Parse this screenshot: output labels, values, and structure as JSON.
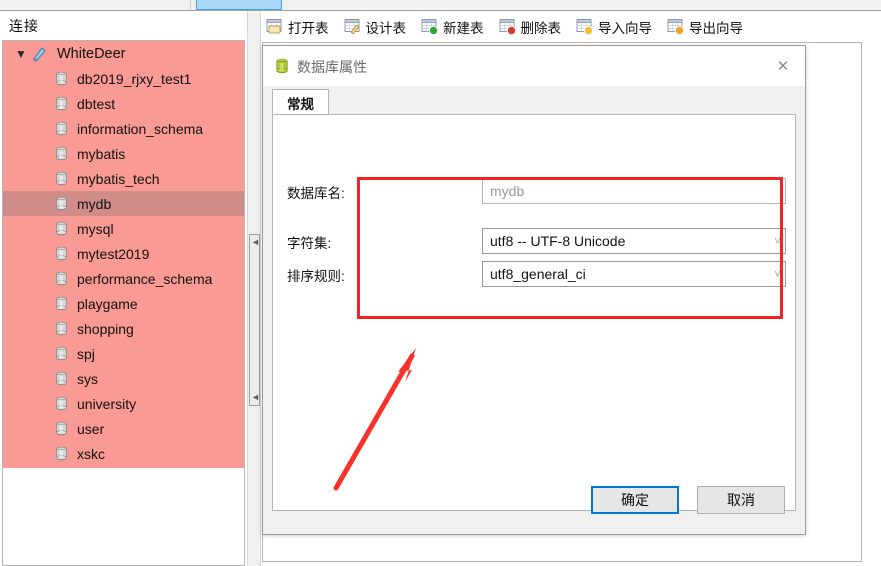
{
  "window": {
    "top_strip_note": "partially visible tab strip"
  },
  "sidebar": {
    "header_title": "连接",
    "root": {
      "label": "WhiteDeer",
      "expand_icon": "chevron-down-icon",
      "conn_icon": "connection-icon",
      "expanded": true
    },
    "databases": [
      {
        "label": "db2019_rjxy_test1",
        "icon": "database-icon",
        "selected": false
      },
      {
        "label": "dbtest",
        "icon": "database-icon",
        "selected": false
      },
      {
        "label": "information_schema",
        "icon": "database-icon",
        "selected": false
      },
      {
        "label": "mybatis",
        "icon": "database-icon",
        "selected": false
      },
      {
        "label": "mybatis_tech",
        "icon": "database-icon",
        "selected": false
      },
      {
        "label": "mydb",
        "icon": "database-icon",
        "selected": true
      },
      {
        "label": "mysql",
        "icon": "database-icon",
        "selected": false
      },
      {
        "label": "mytest2019",
        "icon": "database-icon",
        "selected": false
      },
      {
        "label": "performance_schema",
        "icon": "database-icon",
        "selected": false
      },
      {
        "label": "playgame",
        "icon": "database-icon",
        "selected": false
      },
      {
        "label": "shopping",
        "icon": "database-icon",
        "selected": false
      },
      {
        "label": "spj",
        "icon": "database-icon",
        "selected": false
      },
      {
        "label": "sys",
        "icon": "database-icon",
        "selected": false
      },
      {
        "label": "university",
        "icon": "database-icon",
        "selected": false
      },
      {
        "label": "user",
        "icon": "database-icon",
        "selected": false
      },
      {
        "label": "xskc",
        "icon": "database-icon",
        "selected": false
      }
    ],
    "colors": {
      "tree_background": "#fa9a94",
      "selected_row": "#cf8c89"
    }
  },
  "splitter": {
    "name": "pane-splitter",
    "arrow_top": "collapse-left-arrow",
    "arrow_bottom": "collapse-left-arrow"
  },
  "toolbar": {
    "items": [
      {
        "label": "打开表",
        "icon": "open-table-icon"
      },
      {
        "label": "设计表",
        "icon": "design-table-icon"
      },
      {
        "label": "新建表",
        "icon": "new-table-icon"
      },
      {
        "label": "删除表",
        "icon": "delete-table-icon"
      },
      {
        "label": "导入向导",
        "icon": "import-wizard-icon"
      },
      {
        "label": "导出向导",
        "icon": "export-wizard-icon"
      }
    ]
  },
  "dialog": {
    "title": "数据库属性",
    "title_icon": "database-icon",
    "close_icon": "close-icon",
    "tabs": [
      {
        "label": "常规",
        "active": true
      }
    ],
    "fields": [
      {
        "label": "数据库名:",
        "value": "mydb",
        "type": "text",
        "readonly": true
      },
      {
        "label": "字符集:",
        "value": "utf8 -- UTF-8 Unicode",
        "type": "combo",
        "readonly": false,
        "arrow_icon": "chevron-down-icon"
      },
      {
        "label": "排序规则:",
        "value": "utf8_general_ci",
        "type": "combo",
        "readonly": false,
        "arrow_icon": "chevron-down-icon"
      }
    ],
    "buttons": {
      "ok": "确定",
      "cancel": "取消"
    }
  },
  "annotations": {
    "highlight_rect": {
      "name": "red-highlight-rectangle",
      "color": "#f22323"
    },
    "arrow": {
      "name": "red-pointer-arrow",
      "color": "#f8312a"
    }
  }
}
